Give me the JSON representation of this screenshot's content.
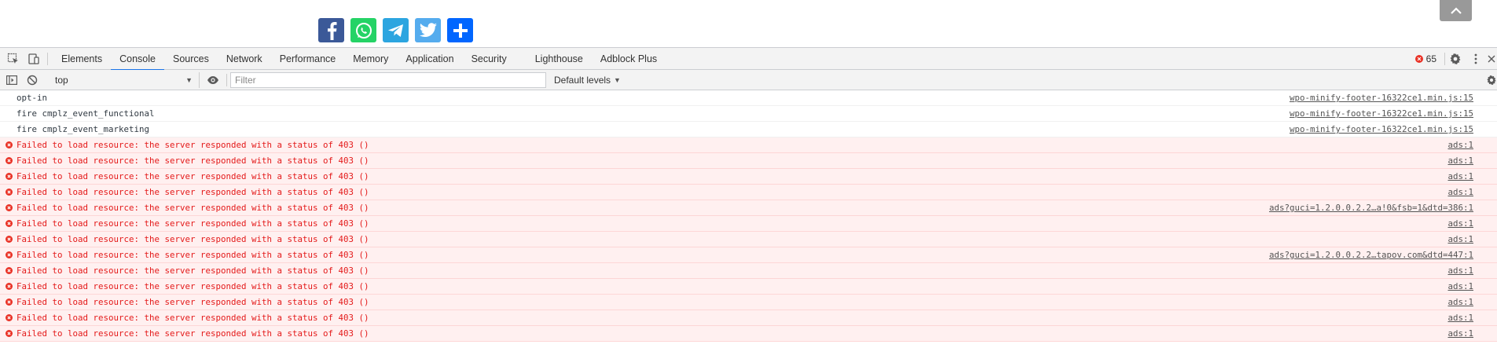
{
  "page": {
    "share_buttons": [
      {
        "name": "facebook",
        "icon": "facebook-icon",
        "color": "#3b5998"
      },
      {
        "name": "whatsapp",
        "icon": "whatsapp-icon",
        "color": "#25d366"
      },
      {
        "name": "telegram",
        "icon": "telegram-icon",
        "color": "#2ca5e0"
      },
      {
        "name": "twitter",
        "icon": "twitter-icon",
        "color": "#55acee"
      },
      {
        "name": "share-more",
        "icon": "plus-icon",
        "color": "#0166ff"
      }
    ],
    "scroll_top_icon": "chevron-up-icon"
  },
  "devtools": {
    "tabs": [
      "Elements",
      "Console",
      "Sources",
      "Network",
      "Performance",
      "Memory",
      "Application",
      "Security",
      "Lighthouse",
      "Adblock Plus"
    ],
    "active_tab": "Console",
    "error_count": "65",
    "toolbar": {
      "context": "top",
      "filter_placeholder": "Filter",
      "levels": "Default levels"
    },
    "messages": [
      {
        "level": "log",
        "text": "opt-in",
        "source": "wpo-minify-footer-16322ce1.min.js:15"
      },
      {
        "level": "log",
        "text": "fire cmplz_event_functional",
        "source": "wpo-minify-footer-16322ce1.min.js:15"
      },
      {
        "level": "log",
        "text": "fire cmplz_event_marketing",
        "source": "wpo-minify-footer-16322ce1.min.js:15"
      },
      {
        "level": "error",
        "text": "Failed to load resource: the server responded with a status of 403 ()",
        "source": "ads:1"
      },
      {
        "level": "error",
        "text": "Failed to load resource: the server responded with a status of 403 ()",
        "source": "ads:1"
      },
      {
        "level": "error",
        "text": "Failed to load resource: the server responded with a status of 403 ()",
        "source": "ads:1"
      },
      {
        "level": "error",
        "text": "Failed to load resource: the server responded with a status of 403 ()",
        "source": "ads:1"
      },
      {
        "level": "error",
        "text": "Failed to load resource: the server responded with a status of 403 ()",
        "source": "ads?guci=1.2.0.0.2.2…a!0&fsb=1&dtd=386:1"
      },
      {
        "level": "error",
        "text": "Failed to load resource: the server responded with a status of 403 ()",
        "source": "ads:1"
      },
      {
        "level": "error",
        "text": "Failed to load resource: the server responded with a status of 403 ()",
        "source": "ads:1"
      },
      {
        "level": "error",
        "text": "Failed to load resource: the server responded with a status of 403 ()",
        "source": "ads?guci=1.2.0.0.2.2…tapov.com&dtd=447:1"
      },
      {
        "level": "error",
        "text": "Failed to load resource: the server responded with a status of 403 ()",
        "source": "ads:1"
      },
      {
        "level": "error",
        "text": "Failed to load resource: the server responded with a status of 403 ()",
        "source": "ads:1"
      },
      {
        "level": "error",
        "text": "Failed to load resource: the server responded with a status of 403 ()",
        "source": "ads:1"
      },
      {
        "level": "error",
        "text": "Failed to load resource: the server responded with a status of 403 ()",
        "source": "ads:1"
      },
      {
        "level": "error",
        "text": "Failed to load resource: the server responded with a status of 403 ()",
        "source": "ads:1"
      }
    ]
  }
}
